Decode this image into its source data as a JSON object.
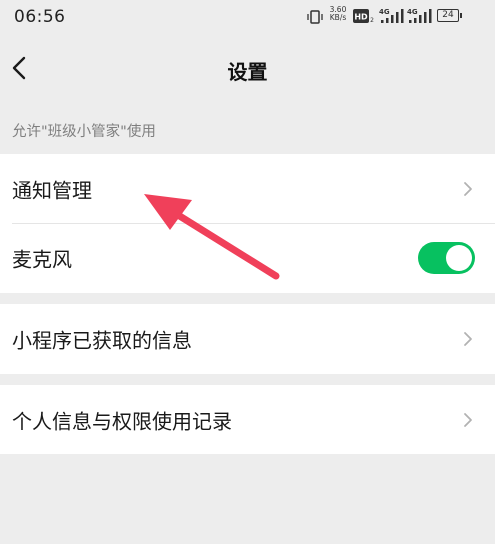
{
  "status_bar": {
    "time": "06:56",
    "net_speed_value": "3.60",
    "net_speed_unit": "KB/s",
    "hd_label": "HD",
    "signal1_label": "4G",
    "signal2_label": "4G",
    "battery": "24"
  },
  "nav": {
    "title": "设置",
    "back_icon": "chevron-left-icon"
  },
  "section_caption": "允许\"班级小管家\"使用",
  "settings": {
    "notification": {
      "label": "通知管理",
      "icon": "chevron-right-icon"
    },
    "microphone": {
      "label": "麦克风",
      "enabled": true
    },
    "miniprogram_info": {
      "label": "小程序已获取的信息",
      "icon": "chevron-right-icon"
    },
    "privacy_records": {
      "label": "个人信息与权限使用记录",
      "icon": "chevron-right-icon"
    }
  },
  "colors": {
    "background": "#ededed",
    "card": "#ffffff",
    "toggle_on": "#07c160",
    "annotation_arrow": "#f0405a",
    "caption": "#7f7f7f"
  }
}
